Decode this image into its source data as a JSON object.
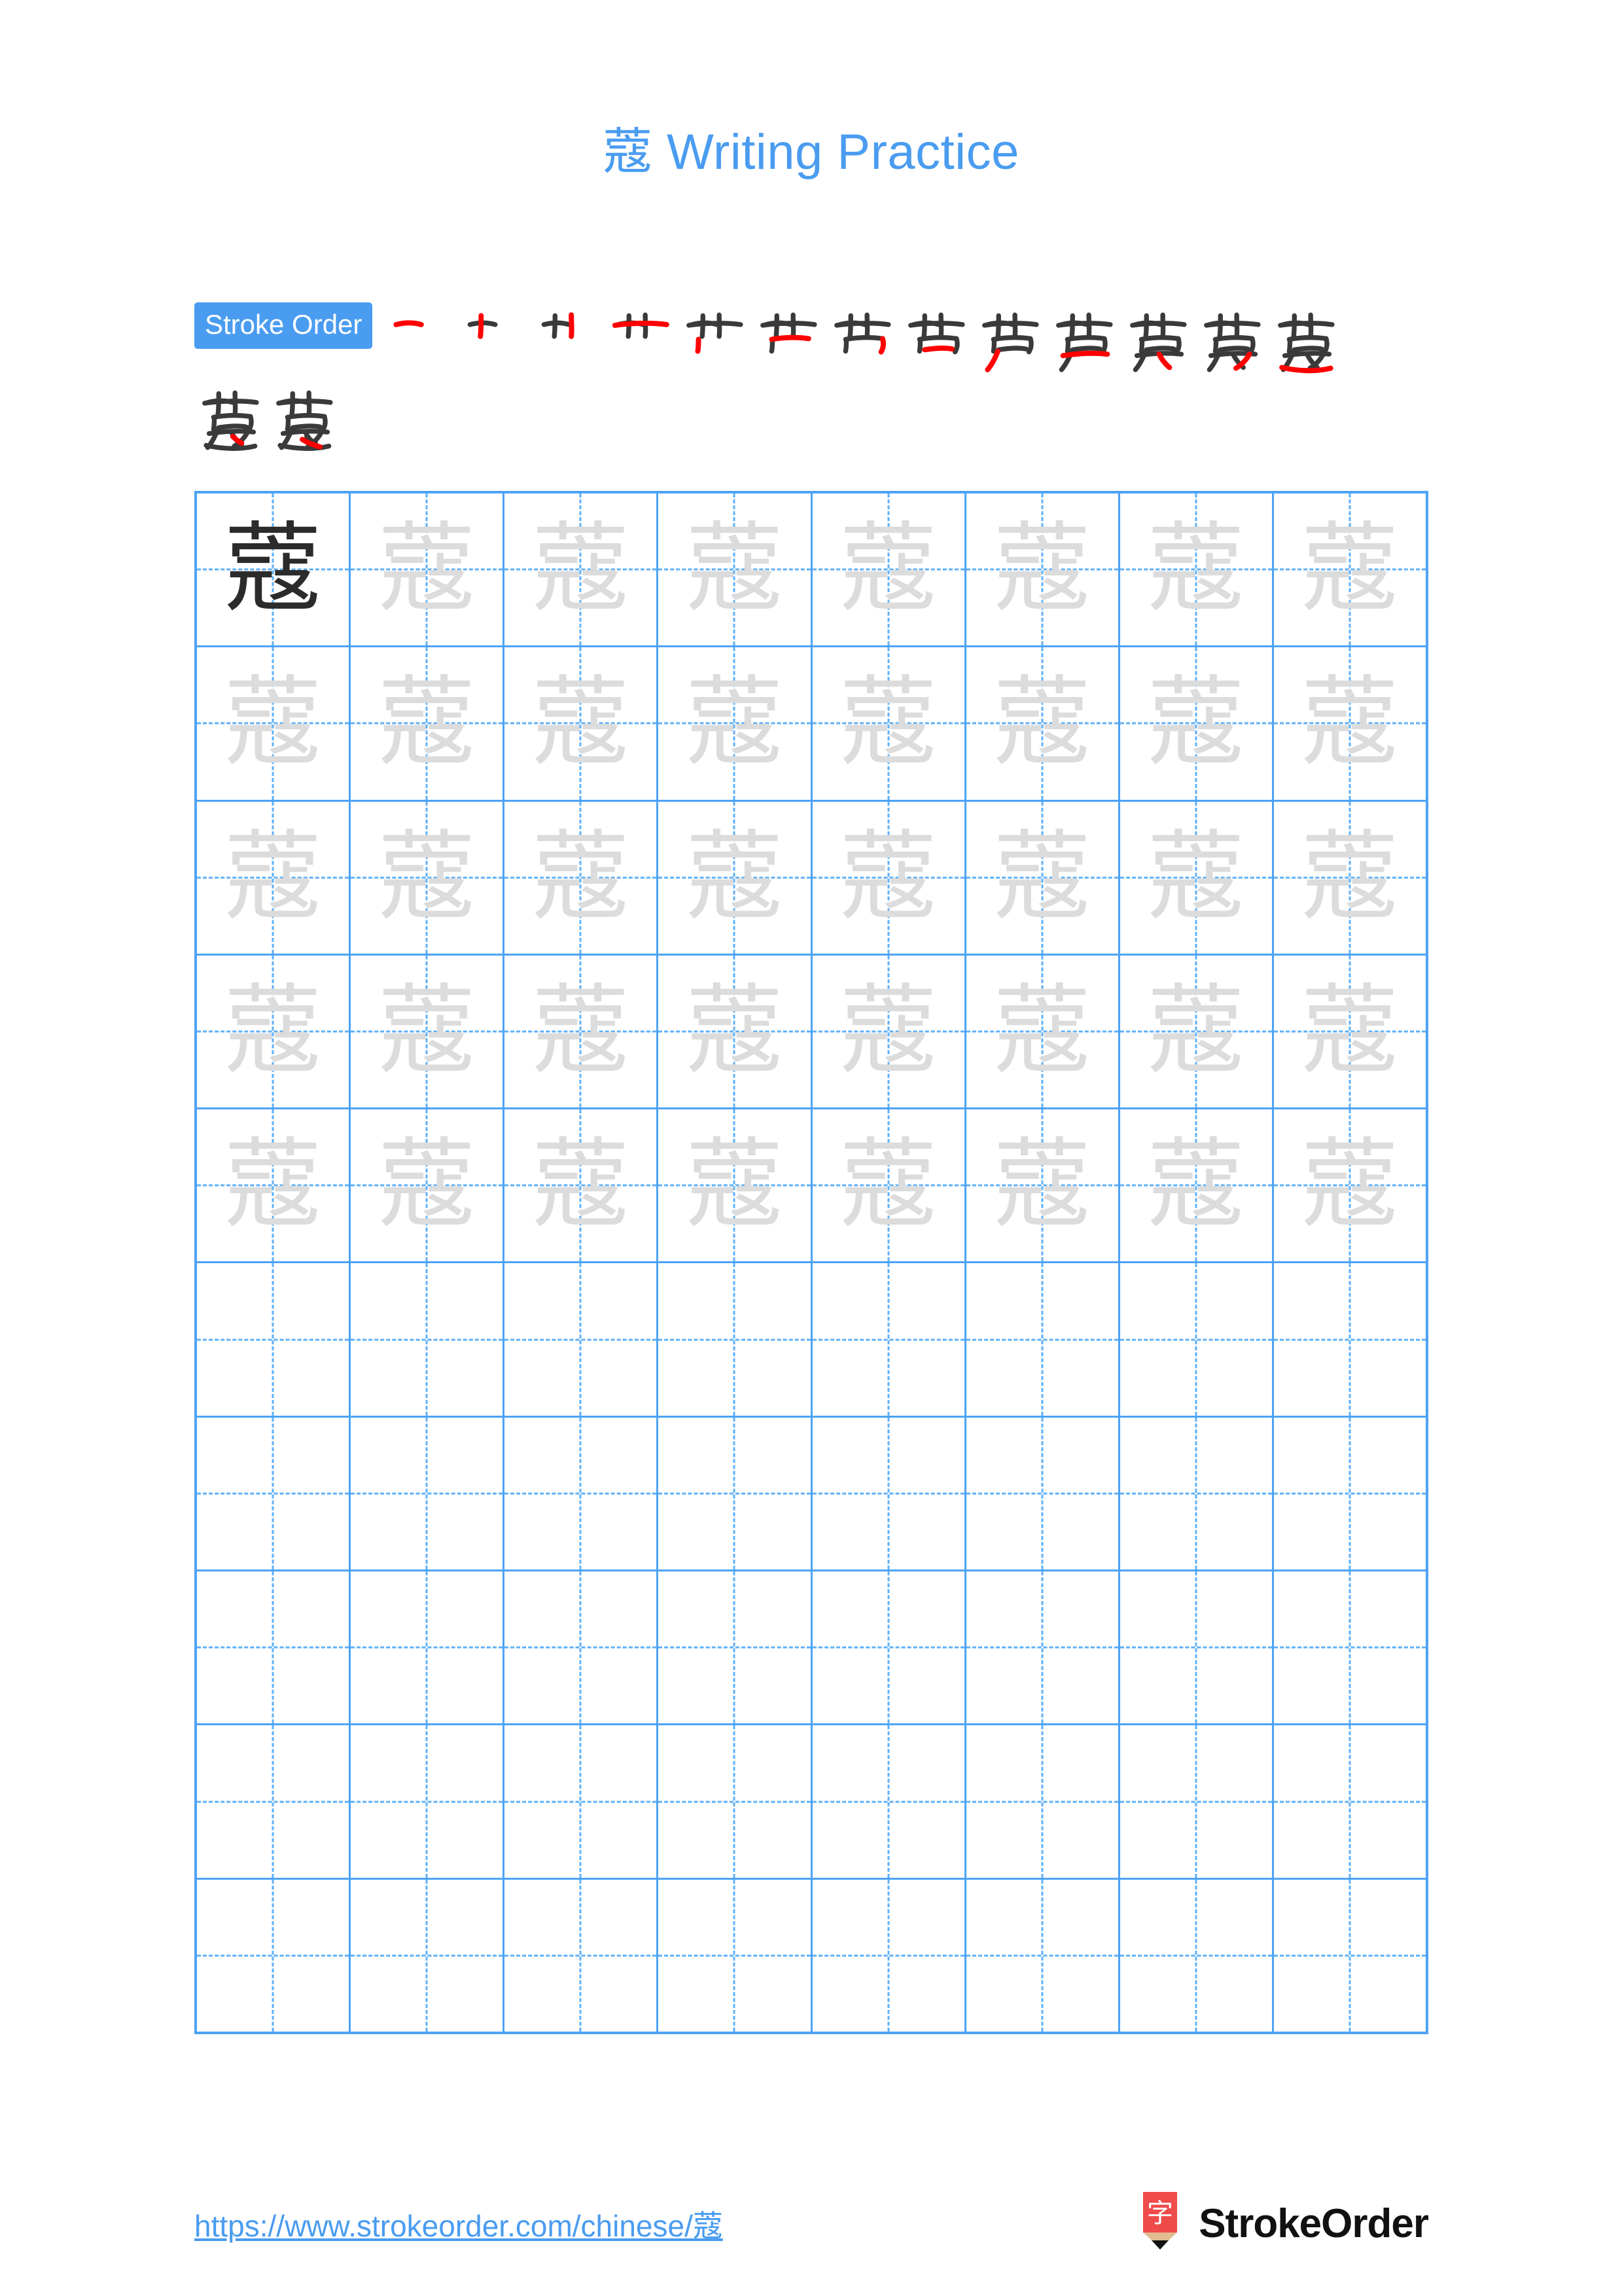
{
  "character": "蔻",
  "title": {
    "char": "蔻",
    "text": " Writing Practice",
    "full": "蔻 Writing Practice",
    "color": "#4a9cf0"
  },
  "stroke_order": {
    "badge_label": "Stroke Order",
    "badge_bg": "#4a9cf0",
    "badge_text_color": "#ffffff",
    "total_strokes": 15,
    "new_stroke_color": "#ff0000",
    "prior_stroke_color": "#3a3a3a",
    "steps_row1_count": 13,
    "steps_row2_count": 2,
    "steps": [
      {
        "index": 1,
        "partial": "一"
      },
      {
        "index": 2,
        "partial": "十"
      },
      {
        "index": 3,
        "partial": "卄"
      },
      {
        "index": 4,
        "partial": "艹"
      },
      {
        "index": 5,
        "partial": "艹"
      },
      {
        "index": 6,
        "partial": "芇"
      },
      {
        "index": 7,
        "partial": "芇"
      },
      {
        "index": 8,
        "partial": "苎"
      },
      {
        "index": 9,
        "partial": "苎"
      },
      {
        "index": 10,
        "partial": "莐"
      },
      {
        "index": 11,
        "partial": "莧"
      },
      {
        "index": 12,
        "partial": "莧"
      },
      {
        "index": 13,
        "partial": "蔻"
      },
      {
        "index": 14,
        "partial": "蔻"
      },
      {
        "index": 15,
        "partial": "蔻"
      }
    ]
  },
  "grid": {
    "rows": 10,
    "columns": 8,
    "border_color": "#4da3f5",
    "guide_color": "#5fb0f7",
    "solid_char_color": "#2b2b2b",
    "ghost_char_color": "#dcdcdc",
    "filled_rows": 5,
    "empty_rows": 5,
    "cells": [
      [
        {
          "char": "蔻",
          "style": "solid"
        },
        {
          "char": "蔻",
          "style": "ghost"
        },
        {
          "char": "蔻",
          "style": "ghost"
        },
        {
          "char": "蔻",
          "style": "ghost"
        },
        {
          "char": "蔻",
          "style": "ghost"
        },
        {
          "char": "蔻",
          "style": "ghost"
        },
        {
          "char": "蔻",
          "style": "ghost"
        },
        {
          "char": "蔻",
          "style": "ghost"
        }
      ],
      [
        {
          "char": "蔻",
          "style": "ghost"
        },
        {
          "char": "蔻",
          "style": "ghost"
        },
        {
          "char": "蔻",
          "style": "ghost"
        },
        {
          "char": "蔻",
          "style": "ghost"
        },
        {
          "char": "蔻",
          "style": "ghost"
        },
        {
          "char": "蔻",
          "style": "ghost"
        },
        {
          "char": "蔻",
          "style": "ghost"
        },
        {
          "char": "蔻",
          "style": "ghost"
        }
      ],
      [
        {
          "char": "蔻",
          "style": "ghost"
        },
        {
          "char": "蔻",
          "style": "ghost"
        },
        {
          "char": "蔻",
          "style": "ghost"
        },
        {
          "char": "蔻",
          "style": "ghost"
        },
        {
          "char": "蔻",
          "style": "ghost"
        },
        {
          "char": "蔻",
          "style": "ghost"
        },
        {
          "char": "蔻",
          "style": "ghost"
        },
        {
          "char": "蔻",
          "style": "ghost"
        }
      ],
      [
        {
          "char": "蔻",
          "style": "ghost"
        },
        {
          "char": "蔻",
          "style": "ghost"
        },
        {
          "char": "蔻",
          "style": "ghost"
        },
        {
          "char": "蔻",
          "style": "ghost"
        },
        {
          "char": "蔻",
          "style": "ghost"
        },
        {
          "char": "蔻",
          "style": "ghost"
        },
        {
          "char": "蔻",
          "style": "ghost"
        },
        {
          "char": "蔻",
          "style": "ghost"
        }
      ],
      [
        {
          "char": "蔻",
          "style": "ghost"
        },
        {
          "char": "蔻",
          "style": "ghost"
        },
        {
          "char": "蔻",
          "style": "ghost"
        },
        {
          "char": "蔻",
          "style": "ghost"
        },
        {
          "char": "蔻",
          "style": "ghost"
        },
        {
          "char": "蔻",
          "style": "ghost"
        },
        {
          "char": "蔻",
          "style": "ghost"
        },
        {
          "char": "蔻",
          "style": "ghost"
        }
      ],
      [
        {
          "char": "",
          "style": "empty"
        },
        {
          "char": "",
          "style": "empty"
        },
        {
          "char": "",
          "style": "empty"
        },
        {
          "char": "",
          "style": "empty"
        },
        {
          "char": "",
          "style": "empty"
        },
        {
          "char": "",
          "style": "empty"
        },
        {
          "char": "",
          "style": "empty"
        },
        {
          "char": "",
          "style": "empty"
        }
      ],
      [
        {
          "char": "",
          "style": "empty"
        },
        {
          "char": "",
          "style": "empty"
        },
        {
          "char": "",
          "style": "empty"
        },
        {
          "char": "",
          "style": "empty"
        },
        {
          "char": "",
          "style": "empty"
        },
        {
          "char": "",
          "style": "empty"
        },
        {
          "char": "",
          "style": "empty"
        },
        {
          "char": "",
          "style": "empty"
        }
      ],
      [
        {
          "char": "",
          "style": "empty"
        },
        {
          "char": "",
          "style": "empty"
        },
        {
          "char": "",
          "style": "empty"
        },
        {
          "char": "",
          "style": "empty"
        },
        {
          "char": "",
          "style": "empty"
        },
        {
          "char": "",
          "style": "empty"
        },
        {
          "char": "",
          "style": "empty"
        },
        {
          "char": "",
          "style": "empty"
        }
      ],
      [
        {
          "char": "",
          "style": "empty"
        },
        {
          "char": "",
          "style": "empty"
        },
        {
          "char": "",
          "style": "empty"
        },
        {
          "char": "",
          "style": "empty"
        },
        {
          "char": "",
          "style": "empty"
        },
        {
          "char": "",
          "style": "empty"
        },
        {
          "char": "",
          "style": "empty"
        },
        {
          "char": "",
          "style": "empty"
        }
      ],
      [
        {
          "char": "",
          "style": "empty"
        },
        {
          "char": "",
          "style": "empty"
        },
        {
          "char": "",
          "style": "empty"
        },
        {
          "char": "",
          "style": "empty"
        },
        {
          "char": "",
          "style": "empty"
        },
        {
          "char": "",
          "style": "empty"
        },
        {
          "char": "",
          "style": "empty"
        },
        {
          "char": "",
          "style": "empty"
        }
      ]
    ]
  },
  "footer": {
    "url": "https://www.strokeorder.com/chinese/蔻",
    "url_color": "#4a9cf0",
    "brand_name": "StrokeOrder",
    "brand_logo_char": "字",
    "brand_logo_color": "#ef4b4b",
    "brand_logo_wood_color": "#e2bd91"
  }
}
